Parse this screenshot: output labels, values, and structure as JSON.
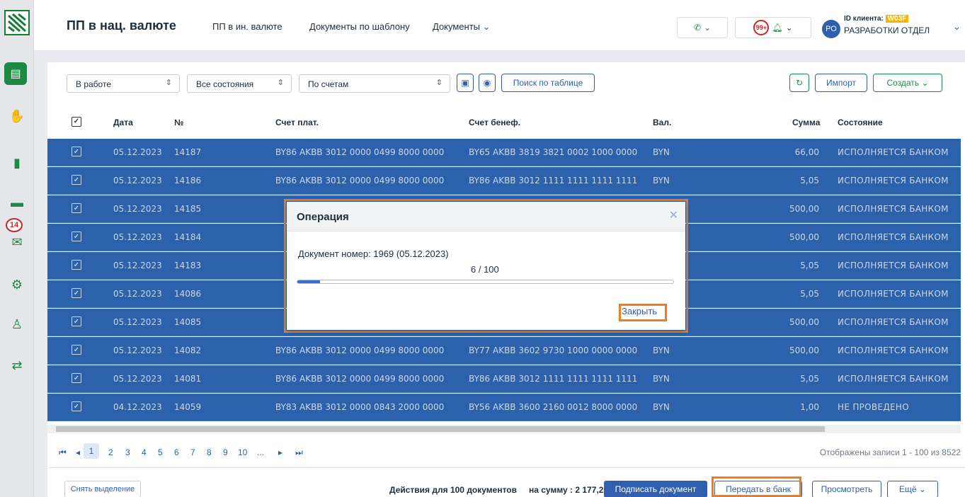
{
  "header": {
    "title": "ПП в нац. валюте",
    "links": [
      "ПП в ин. валюте",
      "Документы по шаблону",
      "Документы"
    ],
    "notif_count": "99+",
    "avatar": "РО",
    "client_id_label": "ID клиента:",
    "client_id": "W03F",
    "client_name": "РАЗРАБОТКИ ОТДЕЛ"
  },
  "sidebar": {
    "mail_badge": "14"
  },
  "toolbar": {
    "filter1": "В работе",
    "filter2": "Все состояния",
    "filter3": "По счетам",
    "search": "Поиск по таблице",
    "import": "Импорт",
    "create": "Создать"
  },
  "table": {
    "headers": {
      "date": "Дата",
      "num": "№",
      "payer": "Счет плат.",
      "benef": "Счет бенеф.",
      "cur": "Вал.",
      "sum": "Сумма",
      "state": "Состояние"
    },
    "rows": [
      {
        "date": "05.12.2023",
        "num": "14187",
        "payer": "BY86 AKBB 3012 0000 0499 8000 0000",
        "benef": "BY65 AKBB 3819 3821 0002 1000 0000",
        "cur": "BYN",
        "sum": "66,00",
        "state": "исполняется банком"
      },
      {
        "date": "05.12.2023",
        "num": "14186",
        "payer": "BY86 AKBB 3012 0000 0499 8000 0000",
        "benef": "BY86 AKBB 3012 1111 1111 1111 1111",
        "cur": "BYN",
        "sum": "5,05",
        "state": "исполняется банком"
      },
      {
        "date": "05.12.2023",
        "num": "14185",
        "payer": "",
        "benef": "",
        "cur": "",
        "sum": "500,00",
        "state": "исполняется банком"
      },
      {
        "date": "05.12.2023",
        "num": "14184",
        "payer": "",
        "benef": "",
        "cur": "",
        "sum": "500,00",
        "state": "исполняется банком"
      },
      {
        "date": "05.12.2023",
        "num": "14183",
        "payer": "",
        "benef": "",
        "cur": "",
        "sum": "5,05",
        "state": "исполняется банком"
      },
      {
        "date": "05.12.2023",
        "num": "14086",
        "payer": "",
        "benef": "",
        "cur": "",
        "sum": "5,05",
        "state": "исполняется банком"
      },
      {
        "date": "05.12.2023",
        "num": "14085",
        "payer": "",
        "benef": "",
        "cur": "",
        "sum": "500,00",
        "state": "исполняется банком"
      },
      {
        "date": "05.12.2023",
        "num": "14082",
        "payer": "BY86 AKBB 3012 0000 0499 8000 0000",
        "benef": "BY77 AKBB 3602 9730 1000 0000 0000",
        "cur": "BYN",
        "sum": "500,00",
        "state": "исполняется банком"
      },
      {
        "date": "05.12.2023",
        "num": "14081",
        "payer": "BY86 AKBB 3012 0000 0499 8000 0000",
        "benef": "BY86 AKBB 3012 1111 1111 1111 1111",
        "cur": "BYN",
        "sum": "5,05",
        "state": "исполняется банком"
      },
      {
        "date": "04.12.2023",
        "num": "14059",
        "payer": "BY83 AKBB 3012 0000 0843 2000 0000",
        "benef": "BY56 AKBB 3600 2160 0012 8000 0000",
        "cur": "BYN",
        "sum": "1,00",
        "state": "не проведено"
      }
    ]
  },
  "pager": {
    "pages": [
      "1",
      "2",
      "3",
      "4",
      "5",
      "6",
      "7",
      "8",
      "9",
      "10",
      "..."
    ],
    "records": "Отображены записи 1 - 100 из 8522"
  },
  "footer": {
    "deselect": "Снять выделение",
    "actions": "Действия для 100 документов",
    "sum": "на сумму : 2 177,20",
    "sign": "Подписать документ",
    "send": "Передать в банк",
    "view": "Просмотреть",
    "more": "Ещё"
  },
  "modal": {
    "title": "Операция",
    "doc": "Документ номер: 1969 (05.12.2023)",
    "progress_text": "6 / 100",
    "progress_fraction": 0.06,
    "close": "Закрыть"
  }
}
